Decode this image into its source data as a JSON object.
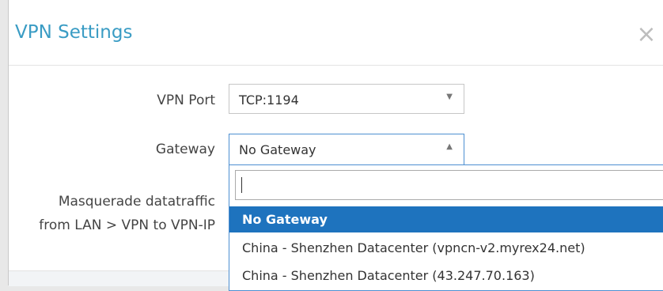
{
  "dialog": {
    "title": "VPN Settings",
    "close_glyph": "×"
  },
  "form": {
    "vpn_port_label": "VPN Port",
    "vpn_port_value": "TCP:1194",
    "gateway_label": "Gateway",
    "gateway_value": "No Gateway",
    "masquerade_label_line1": "Masquerade datatraffic",
    "masquerade_label_line2": "from LAN > VPN to VPN-IP"
  },
  "icons": {
    "dropdown_closed": "▼",
    "dropdown_open": "▲"
  },
  "gateway_dropdown": {
    "search_value": "",
    "options": [
      {
        "label": "No Gateway",
        "selected": true
      },
      {
        "label": "China - Shenzhen Datacenter (vpncn-v2.myrex24.net)",
        "selected": false
      },
      {
        "label": "China - Shenzhen Datacenter (43.247.70.163)",
        "selected": false
      }
    ]
  },
  "colors": {
    "title": "#3a9cc4",
    "selected_option_bg": "#1e73be",
    "focus_border": "#4d8fd1"
  }
}
